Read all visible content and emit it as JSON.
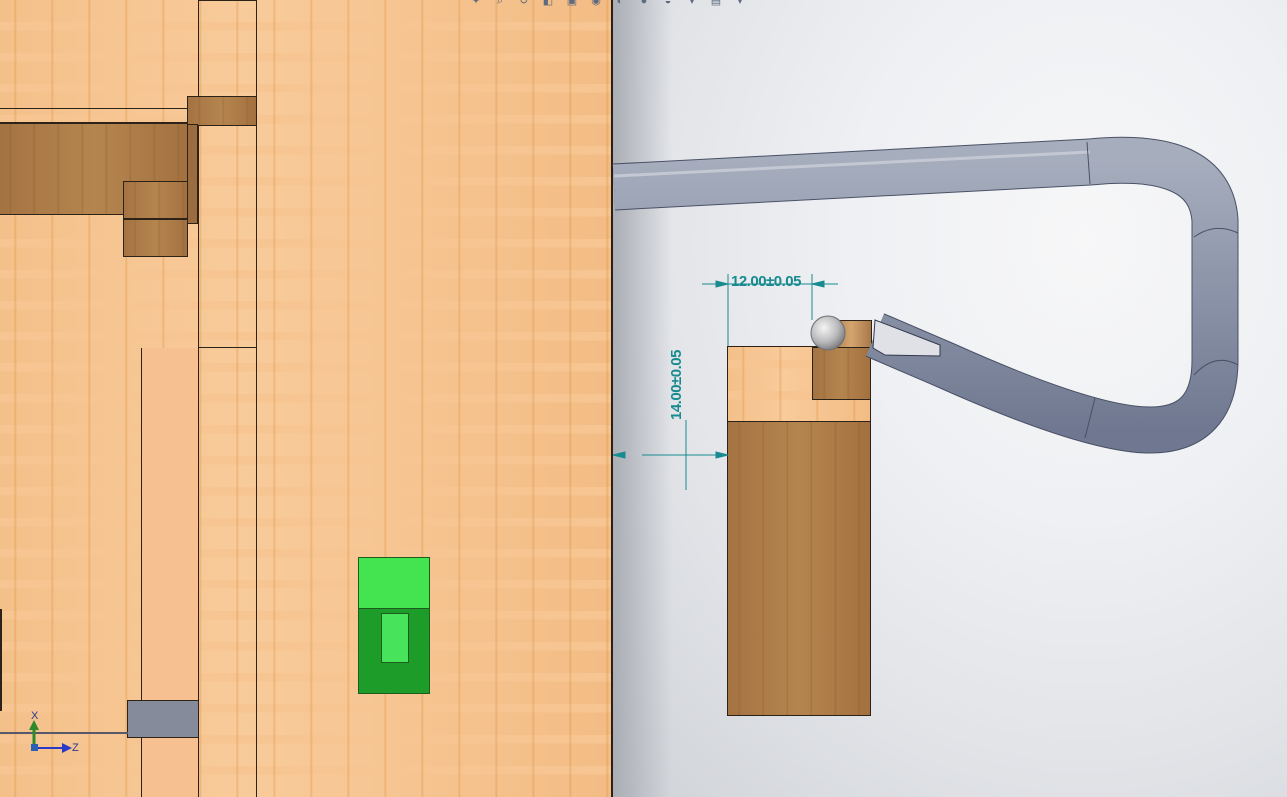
{
  "app": {
    "name": "CAD 3D viewport"
  },
  "toolbar": {
    "icons": [
      "zoom-to-fit-icon",
      "zoom-area-icon",
      "previous-view-icon",
      "section-view-icon",
      "view-orientation-icon",
      "display-style-icon",
      "hide-show-icon",
      "appearance-icon",
      "scene-icon",
      "view-settings-icon",
      "monitor-icon",
      "dropdown-arrow-icon"
    ]
  },
  "dimensions": {
    "horizontal": "12.00±0.05",
    "vertical": "14.00±0.05"
  },
  "triad": {
    "axis_up": "X",
    "axis_right": "Z"
  },
  "colors": {
    "dimension": "#178b8f",
    "tube": "#8f98ab",
    "wood_light": "#f6c591",
    "wood_dark": "#a9794a",
    "green_part": "#3fe14d",
    "triad_x": "#2c8a2c",
    "triad_z": "#2b39c9"
  }
}
